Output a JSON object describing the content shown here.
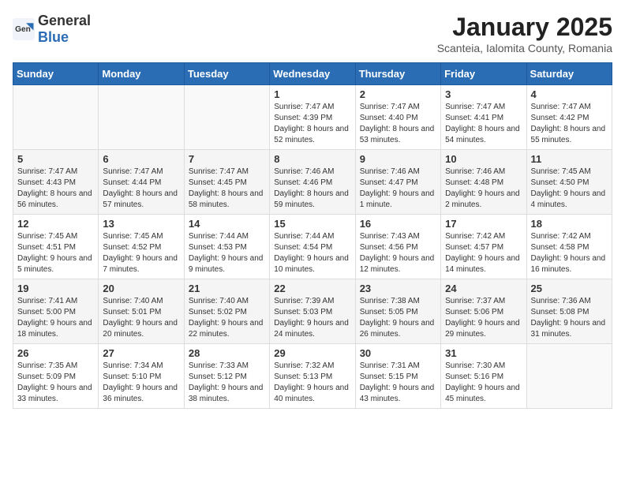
{
  "header": {
    "logo_general": "General",
    "logo_blue": "Blue",
    "title": "January 2025",
    "subtitle": "Scanteia, Ialomita County, Romania"
  },
  "days_of_week": [
    "Sunday",
    "Monday",
    "Tuesday",
    "Wednesday",
    "Thursday",
    "Friday",
    "Saturday"
  ],
  "weeks": [
    [
      {
        "day": null,
        "info": null
      },
      {
        "day": null,
        "info": null
      },
      {
        "day": null,
        "info": null
      },
      {
        "day": "1",
        "info": "Sunrise: 7:47 AM\nSunset: 4:39 PM\nDaylight: 8 hours and 52 minutes."
      },
      {
        "day": "2",
        "info": "Sunrise: 7:47 AM\nSunset: 4:40 PM\nDaylight: 8 hours and 53 minutes."
      },
      {
        "day": "3",
        "info": "Sunrise: 7:47 AM\nSunset: 4:41 PM\nDaylight: 8 hours and 54 minutes."
      },
      {
        "day": "4",
        "info": "Sunrise: 7:47 AM\nSunset: 4:42 PM\nDaylight: 8 hours and 55 minutes."
      }
    ],
    [
      {
        "day": "5",
        "info": "Sunrise: 7:47 AM\nSunset: 4:43 PM\nDaylight: 8 hours and 56 minutes."
      },
      {
        "day": "6",
        "info": "Sunrise: 7:47 AM\nSunset: 4:44 PM\nDaylight: 8 hours and 57 minutes."
      },
      {
        "day": "7",
        "info": "Sunrise: 7:47 AM\nSunset: 4:45 PM\nDaylight: 8 hours and 58 minutes."
      },
      {
        "day": "8",
        "info": "Sunrise: 7:46 AM\nSunset: 4:46 PM\nDaylight: 8 hours and 59 minutes."
      },
      {
        "day": "9",
        "info": "Sunrise: 7:46 AM\nSunset: 4:47 PM\nDaylight: 9 hours and 1 minute."
      },
      {
        "day": "10",
        "info": "Sunrise: 7:46 AM\nSunset: 4:48 PM\nDaylight: 9 hours and 2 minutes."
      },
      {
        "day": "11",
        "info": "Sunrise: 7:45 AM\nSunset: 4:50 PM\nDaylight: 9 hours and 4 minutes."
      }
    ],
    [
      {
        "day": "12",
        "info": "Sunrise: 7:45 AM\nSunset: 4:51 PM\nDaylight: 9 hours and 5 minutes."
      },
      {
        "day": "13",
        "info": "Sunrise: 7:45 AM\nSunset: 4:52 PM\nDaylight: 9 hours and 7 minutes."
      },
      {
        "day": "14",
        "info": "Sunrise: 7:44 AM\nSunset: 4:53 PM\nDaylight: 9 hours and 9 minutes."
      },
      {
        "day": "15",
        "info": "Sunrise: 7:44 AM\nSunset: 4:54 PM\nDaylight: 9 hours and 10 minutes."
      },
      {
        "day": "16",
        "info": "Sunrise: 7:43 AM\nSunset: 4:56 PM\nDaylight: 9 hours and 12 minutes."
      },
      {
        "day": "17",
        "info": "Sunrise: 7:42 AM\nSunset: 4:57 PM\nDaylight: 9 hours and 14 minutes."
      },
      {
        "day": "18",
        "info": "Sunrise: 7:42 AM\nSunset: 4:58 PM\nDaylight: 9 hours and 16 minutes."
      }
    ],
    [
      {
        "day": "19",
        "info": "Sunrise: 7:41 AM\nSunset: 5:00 PM\nDaylight: 9 hours and 18 minutes."
      },
      {
        "day": "20",
        "info": "Sunrise: 7:40 AM\nSunset: 5:01 PM\nDaylight: 9 hours and 20 minutes."
      },
      {
        "day": "21",
        "info": "Sunrise: 7:40 AM\nSunset: 5:02 PM\nDaylight: 9 hours and 22 minutes."
      },
      {
        "day": "22",
        "info": "Sunrise: 7:39 AM\nSunset: 5:03 PM\nDaylight: 9 hours and 24 minutes."
      },
      {
        "day": "23",
        "info": "Sunrise: 7:38 AM\nSunset: 5:05 PM\nDaylight: 9 hours and 26 minutes."
      },
      {
        "day": "24",
        "info": "Sunrise: 7:37 AM\nSunset: 5:06 PM\nDaylight: 9 hours and 29 minutes."
      },
      {
        "day": "25",
        "info": "Sunrise: 7:36 AM\nSunset: 5:08 PM\nDaylight: 9 hours and 31 minutes."
      }
    ],
    [
      {
        "day": "26",
        "info": "Sunrise: 7:35 AM\nSunset: 5:09 PM\nDaylight: 9 hours and 33 minutes."
      },
      {
        "day": "27",
        "info": "Sunrise: 7:34 AM\nSunset: 5:10 PM\nDaylight: 9 hours and 36 minutes."
      },
      {
        "day": "28",
        "info": "Sunrise: 7:33 AM\nSunset: 5:12 PM\nDaylight: 9 hours and 38 minutes."
      },
      {
        "day": "29",
        "info": "Sunrise: 7:32 AM\nSunset: 5:13 PM\nDaylight: 9 hours and 40 minutes."
      },
      {
        "day": "30",
        "info": "Sunrise: 7:31 AM\nSunset: 5:15 PM\nDaylight: 9 hours and 43 minutes."
      },
      {
        "day": "31",
        "info": "Sunrise: 7:30 AM\nSunset: 5:16 PM\nDaylight: 9 hours and 45 minutes."
      },
      {
        "day": null,
        "info": null
      }
    ]
  ]
}
